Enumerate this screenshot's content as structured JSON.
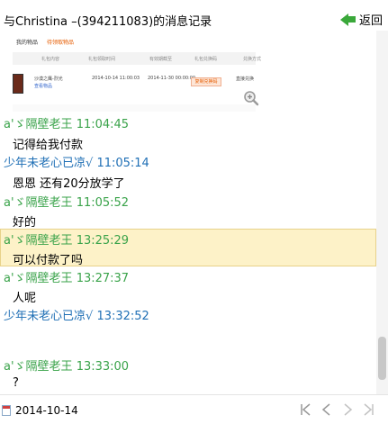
{
  "window": {
    "title": "与Christina –(394211083)的消息记录",
    "back_label": "返回"
  },
  "screenshot": {
    "tab_mine": "我的物品",
    "tab_orders": "待领取物品",
    "col_content": "礼包内容",
    "col_time": "礼包领取时间",
    "col_expire": "有效期截至",
    "col_code": "礼包兑换码",
    "col_status": "兑换方式",
    "product_name": "沙漠之鹰-烈光",
    "product_link": "查看物品",
    "get_time": "2014-10-14 11:00:03",
    "expire_time": "2014-11-30 00:00:00",
    "button_label": "复制兑换码",
    "status_text": "直接兑换"
  },
  "messages": [
    {
      "sender": "a'ゞ隔壁老王",
      "time": "11:04:45",
      "text": "记得给我付款"
    },
    {
      "sender": "少年未老心已凉√",
      "time": "11:05:14",
      "text": "恩恩  还有20分放学了"
    },
    {
      "sender": "a'ゞ隔壁老王",
      "time": "11:05:52",
      "text": "好的"
    },
    {
      "sender": "a'ゞ隔壁老王",
      "time": "13:25:29",
      "text": "可以付款了吗"
    },
    {
      "sender": "a'ゞ隔壁老王",
      "time": "13:27:37",
      "text": "人呢"
    },
    {
      "sender": "少年未老心已凉√",
      "time": "13:32:52",
      "text": ""
    },
    {
      "sender": "a'ゞ隔壁老王",
      "time": "13:33:00",
      "text": "?"
    }
  ],
  "footer": {
    "date": "2014-10-14"
  },
  "colors": {
    "sender_green": "#3aa34a",
    "sender_blue": "#1f6fb5",
    "highlight": "#fdf2c8"
  }
}
